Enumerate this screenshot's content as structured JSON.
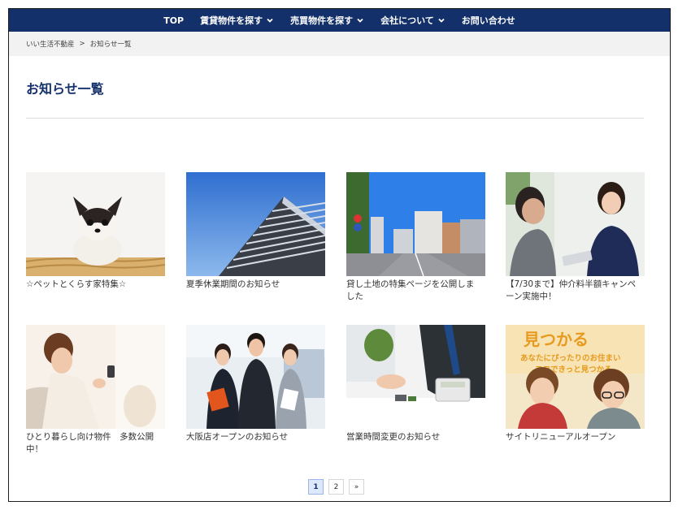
{
  "nav": {
    "items": [
      {
        "label": "TOP",
        "dropdown": false
      },
      {
        "label": "賃貸物件を探す",
        "dropdown": true
      },
      {
        "label": "売買物件を探す",
        "dropdown": true
      },
      {
        "label": "会社について",
        "dropdown": true
      },
      {
        "label": "お問い合わせ",
        "dropdown": false
      }
    ]
  },
  "breadcrumb": {
    "home": "いい生活不動産",
    "separator": ">",
    "current": "お知らせ一覧"
  },
  "page": {
    "title": "お知らせ一覧"
  },
  "posts": [
    {
      "title": "☆ペットとくらす家特集☆",
      "image": "chihuahua-puppy-photo"
    },
    {
      "title": "夏季休業期間のお知らせ",
      "image": "apartment-building-photo"
    },
    {
      "title": "貸し土地の特集ページを公開しました",
      "image": "city-street-photo"
    },
    {
      "title": "【7/30まで】仲介料半額キャンペーン実施中！",
      "image": "business-meeting-photo"
    },
    {
      "title": "ひとり暮らし向け物件　多数公開中！",
      "image": "woman-with-phone-photo"
    },
    {
      "title": "大阪店オープンのお知らせ",
      "image": "office-staff-photo"
    },
    {
      "title": "営業時間変更のお知らせ",
      "image": "calculator-consultation-photo"
    },
    {
      "title": "サイトリニューアルオープン",
      "image": "couple-banner-photo"
    }
  ],
  "banner_text": {
    "line1": "見つかる",
    "line2": "あなたにぴったりのお住まい",
    "line3": "ココできっと見つかる"
  },
  "pagination": {
    "pages": [
      "1",
      "2"
    ],
    "current": "1",
    "next": "»"
  },
  "colors": {
    "nav_bg": "#13306a",
    "title": "#13306a",
    "breadcrumb_bg": "#f2f2f2"
  }
}
